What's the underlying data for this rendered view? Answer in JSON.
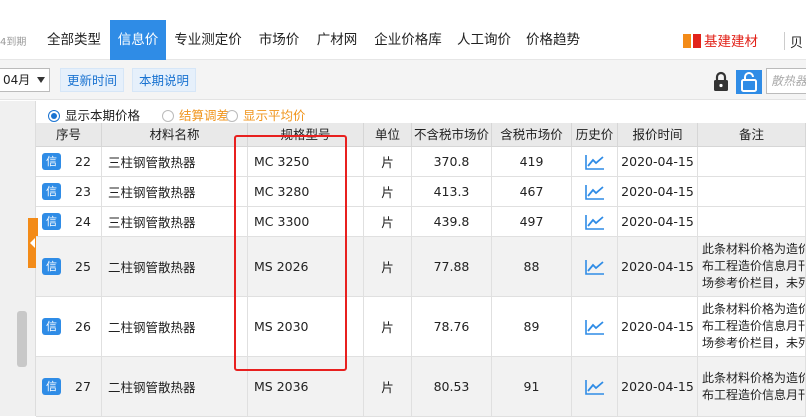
{
  "nav": {
    "prefix": "4到期",
    "tabs": [
      {
        "label": "全部类型",
        "active": false
      },
      {
        "label": "信息价",
        "active": true
      },
      {
        "label": "专业测定价",
        "active": false
      },
      {
        "label": "市场价",
        "active": false
      },
      {
        "label": "广材网",
        "active": false
      },
      {
        "label": "企业价格库",
        "active": false
      },
      {
        "label": "人工询价",
        "active": false
      },
      {
        "label": "价格趋势",
        "active": false
      }
    ],
    "brand": "基建建材",
    "brand_more": "贝"
  },
  "toolbar": {
    "month": "04月",
    "update_time": "更新时间",
    "period_note": "本期说明",
    "search_placeholder": "散热器"
  },
  "radios": [
    {
      "label": "显示本期价格",
      "checked": true
    },
    {
      "label": "结算调差",
      "checked": false
    },
    {
      "label": "显示平均价",
      "checked": false
    }
  ],
  "table": {
    "headers": [
      "序号",
      "材料名称",
      "规格型号",
      "单位",
      "不含税市场价",
      "含税市场价",
      "历史价",
      "报价时间",
      "备注"
    ],
    "badge": "信",
    "rows": [
      {
        "no": "22",
        "name": "三柱钢管散热器",
        "spec": "MC 3250",
        "unit": "片",
        "price_ex": "370.8",
        "price_in": "419",
        "date": "2020-04-15",
        "note": []
      },
      {
        "no": "23",
        "name": "三柱钢管散热器",
        "spec": "MC 3280",
        "unit": "片",
        "price_ex": "413.3",
        "price_in": "467",
        "date": "2020-04-15",
        "note": []
      },
      {
        "no": "24",
        "name": "三柱钢管散热器",
        "spec": "MC 3300",
        "unit": "片",
        "price_ex": "439.8",
        "price_in": "497",
        "date": "2020-04-15",
        "note": []
      },
      {
        "no": "25",
        "name": "二柱钢管散热器",
        "spec": "MS 2026",
        "unit": "片",
        "price_ex": "77.88",
        "price_in": "88",
        "date": "2020-04-15",
        "note": [
          "此条材料价格为造价",
          "布工程造价信息月刊",
          "场参考价栏目，未列"
        ]
      },
      {
        "no": "26",
        "name": "二柱钢管散热器",
        "spec": "MS 2030",
        "unit": "片",
        "price_ex": "78.76",
        "price_in": "89",
        "date": "2020-04-15",
        "note": [
          "此条材料价格为造价",
          "布工程造价信息月刊",
          "场参考价栏目，未列"
        ]
      },
      {
        "no": "27",
        "name": "二柱钢管散热器",
        "spec": "MS 2036",
        "unit": "片",
        "price_ex": "80.53",
        "price_in": "91",
        "date": "2020-04-15",
        "note": [
          "此条材料价格为造价",
          "布工程造价信息月刊"
        ]
      }
    ]
  },
  "colors": {
    "accent": "#2f8ce6",
    "highlight": "#e8201f",
    "orange": "#f0951d"
  }
}
